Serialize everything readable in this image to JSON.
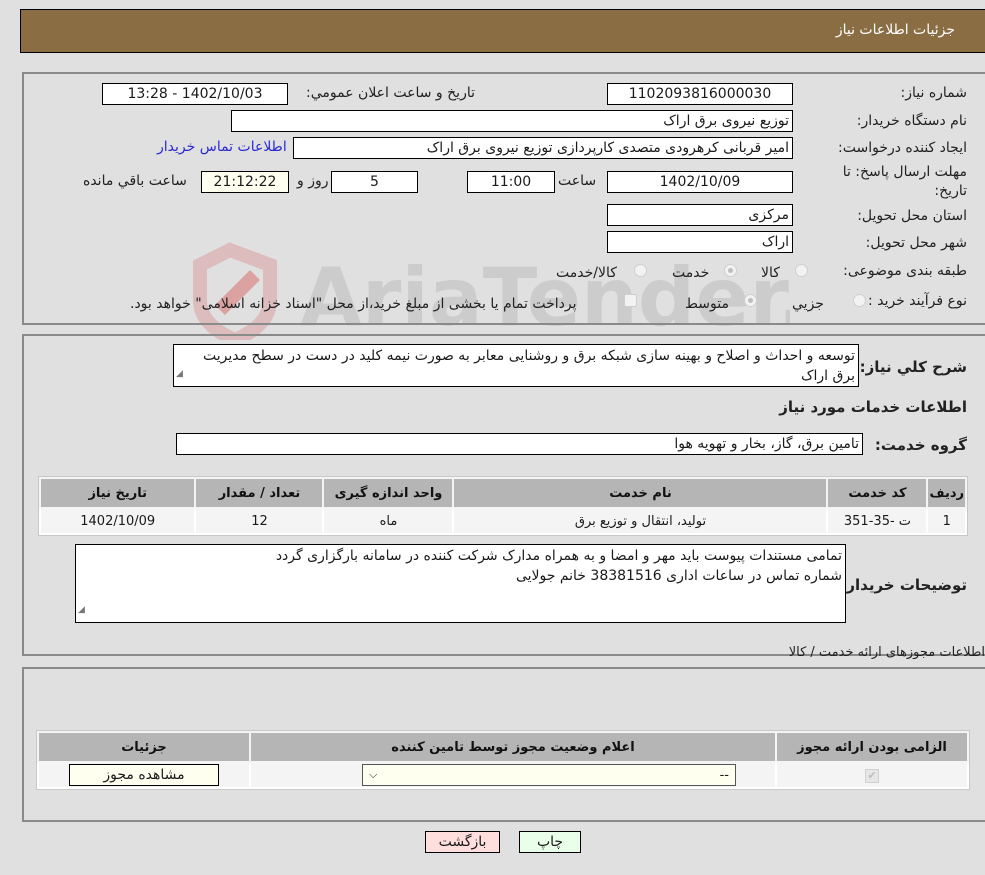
{
  "header": {
    "title": "جزئیات اطلاعات نیاز"
  },
  "need": {
    "need_number_label": "شماره نیاز:",
    "need_number": "1102093816000030",
    "announce_label": "تاریخ و ساعت اعلان عمومي:",
    "announce_value": "1402/10/03 - 13:28",
    "buyer_org_label": "نام دستگاه خريدار:",
    "buyer_org": "توزیع نیروی برق اراک",
    "creator_label": "ایجاد کننده درخواست:",
    "creator": "امیر قربانی کرهرودی متصدی کارپردازی توزیع نیروی برق اراک",
    "buyer_contact_link": "اطلاعات تماس خریدار",
    "deadline_label_line1": "مهلت ارسال پاسخ: تا",
    "deadline_label_line2": "تاریخ:",
    "deadline_date": "1402/10/09",
    "time_label": "ساعت",
    "deadline_time": "11:00",
    "days_value": "5",
    "days_label": "روز و",
    "remaining_time": "21:12:22",
    "remaining_label": "ساعت باقي مانده",
    "province_label": "استان محل تحویل:",
    "province": "مرکزی",
    "city_label": "شهر محل تحویل:",
    "city": "اراک",
    "category_label": "طبقه بندی موضوعی:",
    "category_options": [
      {
        "label": "کالا",
        "selected": false
      },
      {
        "label": "خدمت",
        "selected": true
      },
      {
        "label": "کالا/خدمت",
        "selected": false
      }
    ],
    "process_label": "نوع فرآيند خريد :",
    "process_options": [
      {
        "label": "جزيي",
        "selected": false
      },
      {
        "label": "متوسط",
        "selected": true
      }
    ],
    "treasury_checkbox_label": "پرداخت تمام یا بخشی از مبلغ خرید،از محل \"اسناد خزانه اسلامی\" خواهد بود.",
    "treasury_checked": false
  },
  "details": {
    "summary_label": "شرح كلي نياز:",
    "summary": "توسعه و احداث و اصلاح و بهینه سازی شبکه برق و روشنایی معابر به صورت نیمه کلید در دست در سطح مدیریت برق اراک",
    "services_heading": "اطلاعات خدمات مورد نياز",
    "service_group_label": "گروه خدمت:",
    "service_group": "تامین برق، گاز، بخار و تهویه هوا",
    "table": {
      "headers": [
        "ردیف",
        "کد خدمت",
        "نام خدمت",
        "واحد اندازه گیری",
        "تعداد / مقدار",
        "تاریخ نیاز"
      ],
      "rows": [
        [
          "1",
          "ت -35-351",
          "تولید، انتقال و توزیع برق",
          "ماه",
          "12",
          "1402/10/09"
        ]
      ]
    },
    "buyer_notes_label": "توضیحات خریدار:",
    "buyer_notes_line1": "تمامی مستندات پیوست باید مهر و امضا و به همراه مدارک شرکت کننده در سامانه بارگزاری گردد",
    "buyer_notes_line2": "شماره تماس در ساعات اداری 38381516 خانم جولایی"
  },
  "permits": {
    "title": "اطلاعات مجوزهای ارائه خدمت / کالا",
    "headers": [
      "الزامی بودن ارائه مجوز",
      "اعلام وضعیت مجوز توسط تامین کننده",
      "جزئیات"
    ],
    "row": {
      "required_checked": true,
      "status_selected": "--",
      "view_button": "مشاهده مجوز"
    }
  },
  "footer": {
    "print_button": "چاپ",
    "back_button": "بازگشت"
  },
  "colors": {
    "header_bg": "#8b6d44",
    "print_bg": "#eaffea",
    "back_bg": "#ffdede",
    "link": "#2a2ad0"
  },
  "watermark": {
    "text": "AriaTender.neT"
  }
}
